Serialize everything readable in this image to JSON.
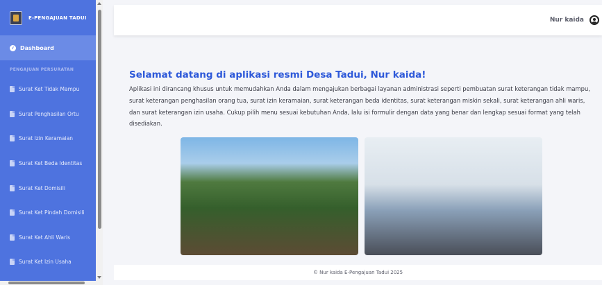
{
  "sidebar": {
    "brand": "E-PENGAJUAN TADUI",
    "dashboard": "Dashboard",
    "section_title": "PENGAJUAN PERSURATAN",
    "items": [
      {
        "label": "Surat Ket Tidak Mampu"
      },
      {
        "label": "Surat Penghasilan Ortu"
      },
      {
        "label": "Surat Izin Keramaian"
      },
      {
        "label": "Surat Ket Beda Identitas"
      },
      {
        "label": "Surat Ket Domisili"
      },
      {
        "label": "Surat Ket Pindah Domisili"
      },
      {
        "label": "Surat Ket Ahli Waris"
      },
      {
        "label": "Surat Ket Izin Usaha"
      }
    ]
  },
  "topbar": {
    "user_name": "Nur kaida"
  },
  "main": {
    "welcome_title": "Selamat datang di aplikasi resmi Desa Tadui, Nur kaida!",
    "description": "Aplikasi ini dirancang khusus untuk memudahkan Anda dalam mengajukan berbagai layanan administrasi seperti pembuatan surat keterangan tidak mampu, surat keterangan penghasilan orang tua, surat izin keramaian, surat keterangan beda identitas, surat keterangan miskin sekali, surat keterangan ahli waris, dan surat keterangan izin usaha. Cukup pilih menu sesuai kebutuhan Anda, lalu isi formulir dengan data yang benar dan lengkap sesuai format yang telah disediakan."
  },
  "footer": {
    "text": "© Nur kaida E-Pengajuan Tadui 2025"
  },
  "colors": {
    "sidebar": "#4e73df",
    "accent": "#2e59d9"
  }
}
